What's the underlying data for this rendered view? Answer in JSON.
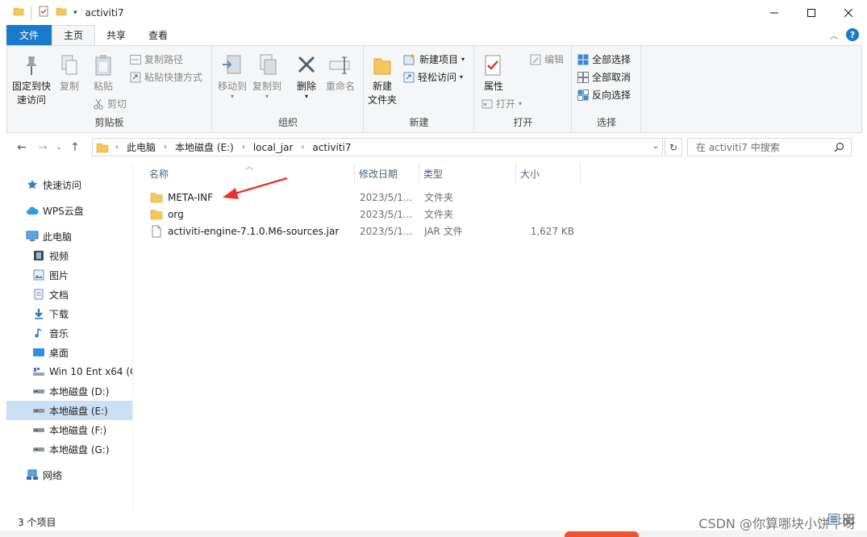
{
  "window": {
    "title": "activiti7",
    "controls": [
      "minimize",
      "maximize",
      "close"
    ]
  },
  "ribbon_tabs": [
    {
      "label": "文件",
      "type": "file"
    },
    {
      "label": "主页",
      "active": true
    },
    {
      "label": "共享"
    },
    {
      "label": "查看"
    }
  ],
  "ribbon": {
    "clipboard": {
      "group_label": "剪贴板",
      "pin_label_1": "固定到快",
      "pin_label_2": "速访问",
      "copy": "复制",
      "paste": "粘贴",
      "copy_path": "复制路径",
      "paste_shortcut": "粘贴快捷方式",
      "cut": "剪切"
    },
    "organize": {
      "group_label": "组织",
      "move_to": "移动到",
      "copy_to": "复制到",
      "delete": "删除",
      "rename": "重命名"
    },
    "new": {
      "group_label": "新建",
      "new_folder_1": "新建",
      "new_folder_2": "文件夹",
      "new_item": "新建项目",
      "easy_access": "轻松访问"
    },
    "open": {
      "group_label": "打开",
      "properties": "属性",
      "open": "打开",
      "edit": "编辑"
    },
    "select": {
      "group_label": "选择",
      "select_all": "全部选择",
      "select_none": "全部取消",
      "invert": "反向选择"
    }
  },
  "address": {
    "crumbs": [
      "此电脑",
      "本地磁盘 (E:)",
      "local_jar",
      "activiti7"
    ],
    "search_placeholder": "在 activiti7 中搜索"
  },
  "nav_pane": {
    "items": [
      {
        "label": "快速访问",
        "icon": "star-icon"
      },
      {
        "label": "WPS云盘",
        "icon": "cloud-icon"
      },
      {
        "label": "此电脑",
        "icon": "computer-icon"
      },
      {
        "label": "视频",
        "icon": "video-icon"
      },
      {
        "label": "图片",
        "icon": "picture-icon"
      },
      {
        "label": "文档",
        "icon": "document-icon"
      },
      {
        "label": "下载",
        "icon": "download-icon"
      },
      {
        "label": "音乐",
        "icon": "music-icon"
      },
      {
        "label": "桌面",
        "icon": "desktop-icon"
      },
      {
        "label": "Win 10 Ent x64 (C",
        "icon": "windows-drive-icon"
      },
      {
        "label": "本地磁盘 (D:)",
        "icon": "drive-icon"
      },
      {
        "label": "本地磁盘 (E:)",
        "icon": "drive-icon",
        "selected": true
      },
      {
        "label": "本地磁盘 (F:)",
        "icon": "drive-icon"
      },
      {
        "label": "本地磁盘 (G:)",
        "icon": "drive-icon"
      },
      {
        "label": "网络",
        "icon": "network-icon"
      }
    ]
  },
  "file_list": {
    "columns": {
      "name": "名称",
      "date": "修改日期",
      "type": "类型",
      "size": "大小"
    },
    "rows": [
      {
        "name": "META-INF",
        "date": "2023/5/1...",
        "type": "文件夹",
        "size": "",
        "icon": "folder-icon"
      },
      {
        "name": "org",
        "date": "2023/5/1...",
        "type": "文件夹",
        "size": "",
        "icon": "folder-icon"
      },
      {
        "name": "activiti-engine-7.1.0.M6-sources.jar",
        "date": "2023/5/1...",
        "type": "JAR 文件",
        "size": "1,627 KB",
        "icon": "file-icon"
      }
    ]
  },
  "status": {
    "item_count": "3 个项目"
  },
  "watermark": "CSDN @你算哪块小饼干呀",
  "colors": {
    "accent": "#1979ca",
    "folder": "#f4c757",
    "selection": "#cce0f5",
    "arrow": "#e8332a"
  }
}
